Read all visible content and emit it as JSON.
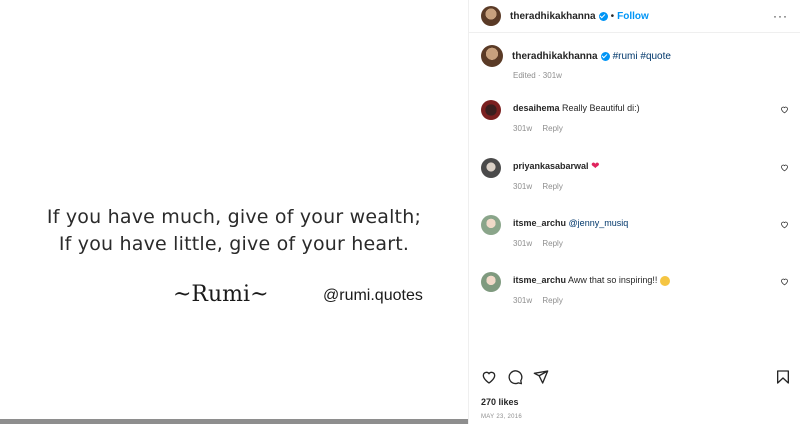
{
  "post": {
    "quote_line_1": "If you have much, give of your wealth;",
    "quote_line_2": "If you have little, give of your heart.",
    "author": "~Rumi~",
    "handle": "@rumi.quotes"
  },
  "header": {
    "username": "theradhikakhanna",
    "dot": "•",
    "follow_label": "Follow",
    "more_icon": "more-horizontal-icon",
    "more_text": "···"
  },
  "caption": {
    "username": "theradhikakhanna",
    "tags": "#rumi #quote",
    "meta": "Edited · 301w"
  },
  "comments": [
    {
      "user": "desaihema",
      "text": "Really Beautiful di:)",
      "age": "301w",
      "reply": "Reply"
    },
    {
      "user": "priyankasabarwal",
      "text": "❤",
      "age": "301w",
      "reply": "Reply"
    },
    {
      "user": "itsme_archu",
      "text": "@jenny_musiq",
      "age": "301w",
      "reply": "Reply"
    },
    {
      "user": "itsme_archu",
      "text": "Aww that so inspiring!! ",
      "age": "301w",
      "reply": "Reply"
    }
  ],
  "footer": {
    "likes": "270 likes",
    "date": "MAY 23, 2016"
  },
  "colors": {
    "accent": "#0095f6",
    "mention": "#00376b",
    "secondary_text": "#8e8e8e",
    "heart": "#e0245e"
  }
}
